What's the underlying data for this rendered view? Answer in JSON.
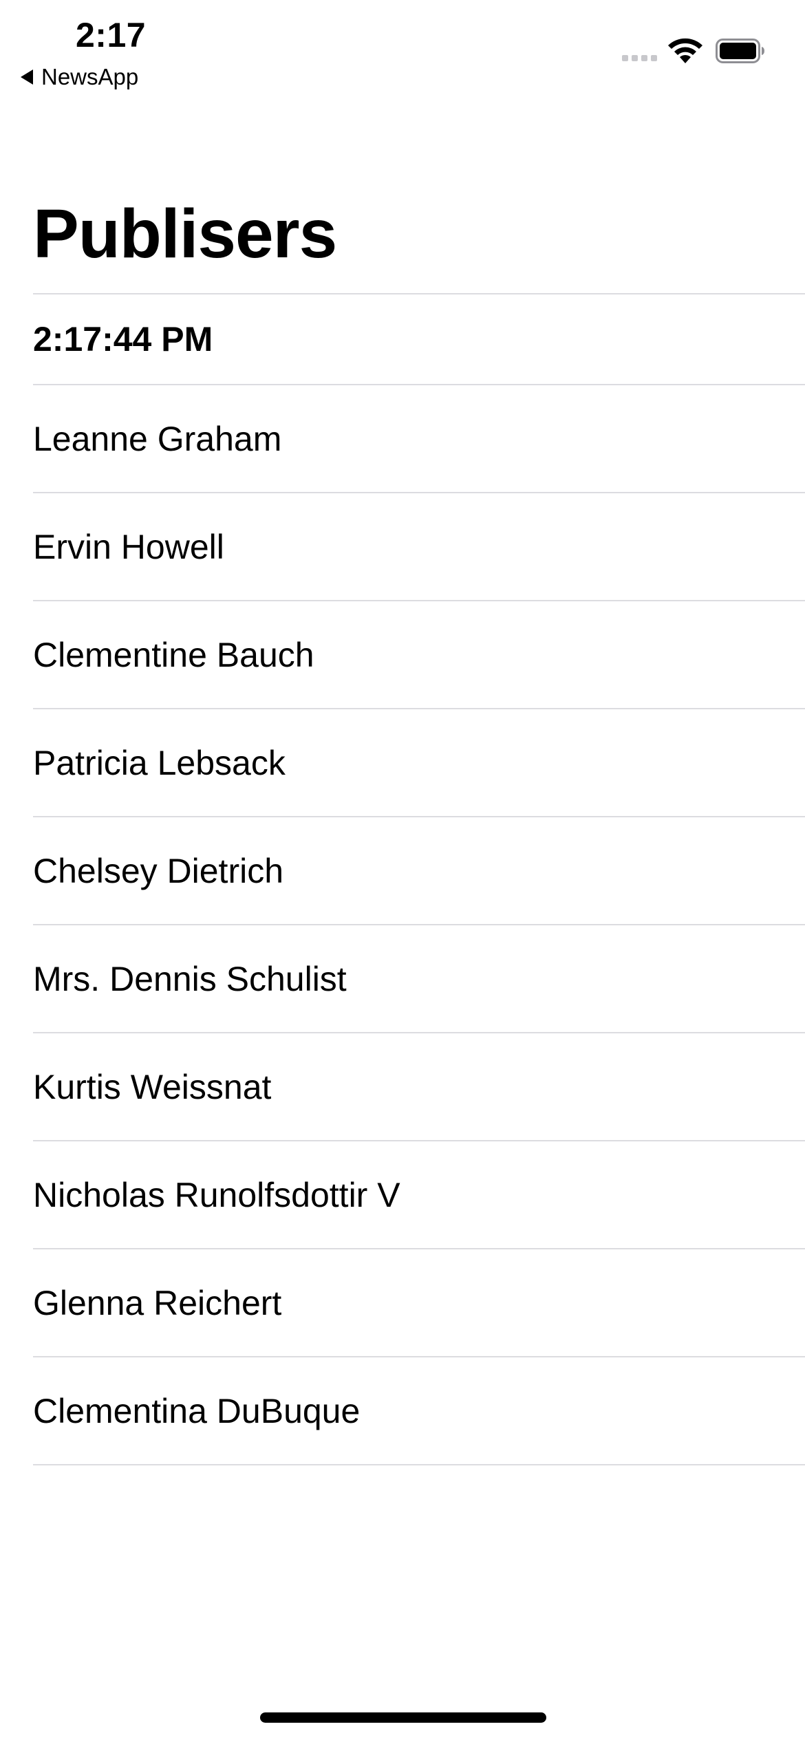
{
  "status_bar": {
    "time": "2:17",
    "back_app": "NewsApp",
    "icons": [
      "signal-icon",
      "wifi-icon",
      "battery-icon"
    ]
  },
  "nav": {
    "title": "Publisers"
  },
  "list": {
    "timestamp": "2:17:44 PM",
    "publishers": [
      "Leanne Graham",
      "Ervin Howell",
      "Clementine Bauch",
      "Patricia Lebsack",
      "Chelsey Dietrich",
      "Mrs. Dennis Schulist",
      "Kurtis Weissnat",
      "Nicholas Runolfsdottir V",
      "Glenna Reichert",
      "Clementina DuBuque"
    ]
  },
  "colors": {
    "background": "#ffffff",
    "text": "#000000",
    "separator": "#dcdce0"
  }
}
